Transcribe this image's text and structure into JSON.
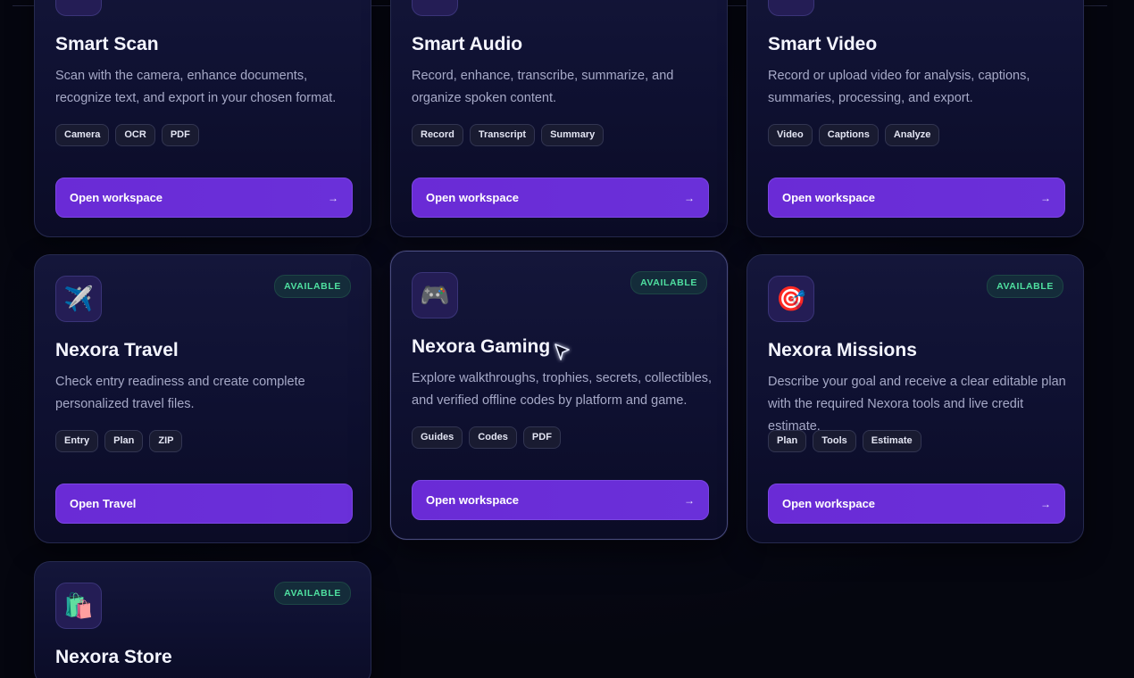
{
  "cards": [
    {
      "title": "Smart Scan",
      "description": "Scan with the camera, enhance documents, recognize text, and export in your chosen format.",
      "tags": [
        "Camera",
        "OCR",
        "PDF"
      ],
      "button_label": "Open workspace",
      "button_arrow": "→"
    },
    {
      "title": "Smart Audio",
      "description": "Record, enhance, transcribe, summarize, and organize spoken content.",
      "tags": [
        "Record",
        "Transcript",
        "Summary"
      ],
      "button_label": "Open workspace",
      "button_arrow": "→"
    },
    {
      "title": "Smart Video",
      "description": "Record or upload video for analysis, captions, summaries, processing, and export.",
      "tags": [
        "Video",
        "Captions",
        "Analyze"
      ],
      "button_label": "Open workspace",
      "button_arrow": "→"
    },
    {
      "title": "Nexora Travel",
      "badge": "AVAILABLE",
      "icon": "airplane-icon",
      "icon_glyph": "✈️",
      "description": "Check entry readiness and create complete personalized travel files.",
      "tags": [
        "Entry",
        "Plan",
        "ZIP"
      ],
      "button_label": "Open Travel"
    },
    {
      "title": "Nexora Gaming",
      "badge": "AVAILABLE",
      "icon": "game-controller-icon",
      "icon_glyph": "🎮",
      "description": "Explore walkthroughs, trophies, secrets, collectibles, and verified offline codes by platform and game.",
      "tags": [
        "Guides",
        "Codes",
        "PDF"
      ],
      "button_label": "Open workspace",
      "button_arrow": "→"
    },
    {
      "title": "Nexora Missions",
      "badge": "AVAILABLE",
      "icon": "target-icon",
      "icon_glyph": "🎯",
      "description": "Describe your goal and receive a clear editable plan with the required Nexora tools and live credit estimate.",
      "tags": [
        "Plan",
        "Tools",
        "Estimate"
      ],
      "button_label": "Open workspace",
      "button_arrow": "→"
    },
    {
      "title": "Nexora Store",
      "badge": "AVAILABLE",
      "icon": "shopping-bags-icon",
      "icon_glyph": "🛍️"
    }
  ],
  "colors": {
    "accent": "#6a2bd6",
    "available_badge_text": "#4fe0a0",
    "background": "#05060f"
  }
}
